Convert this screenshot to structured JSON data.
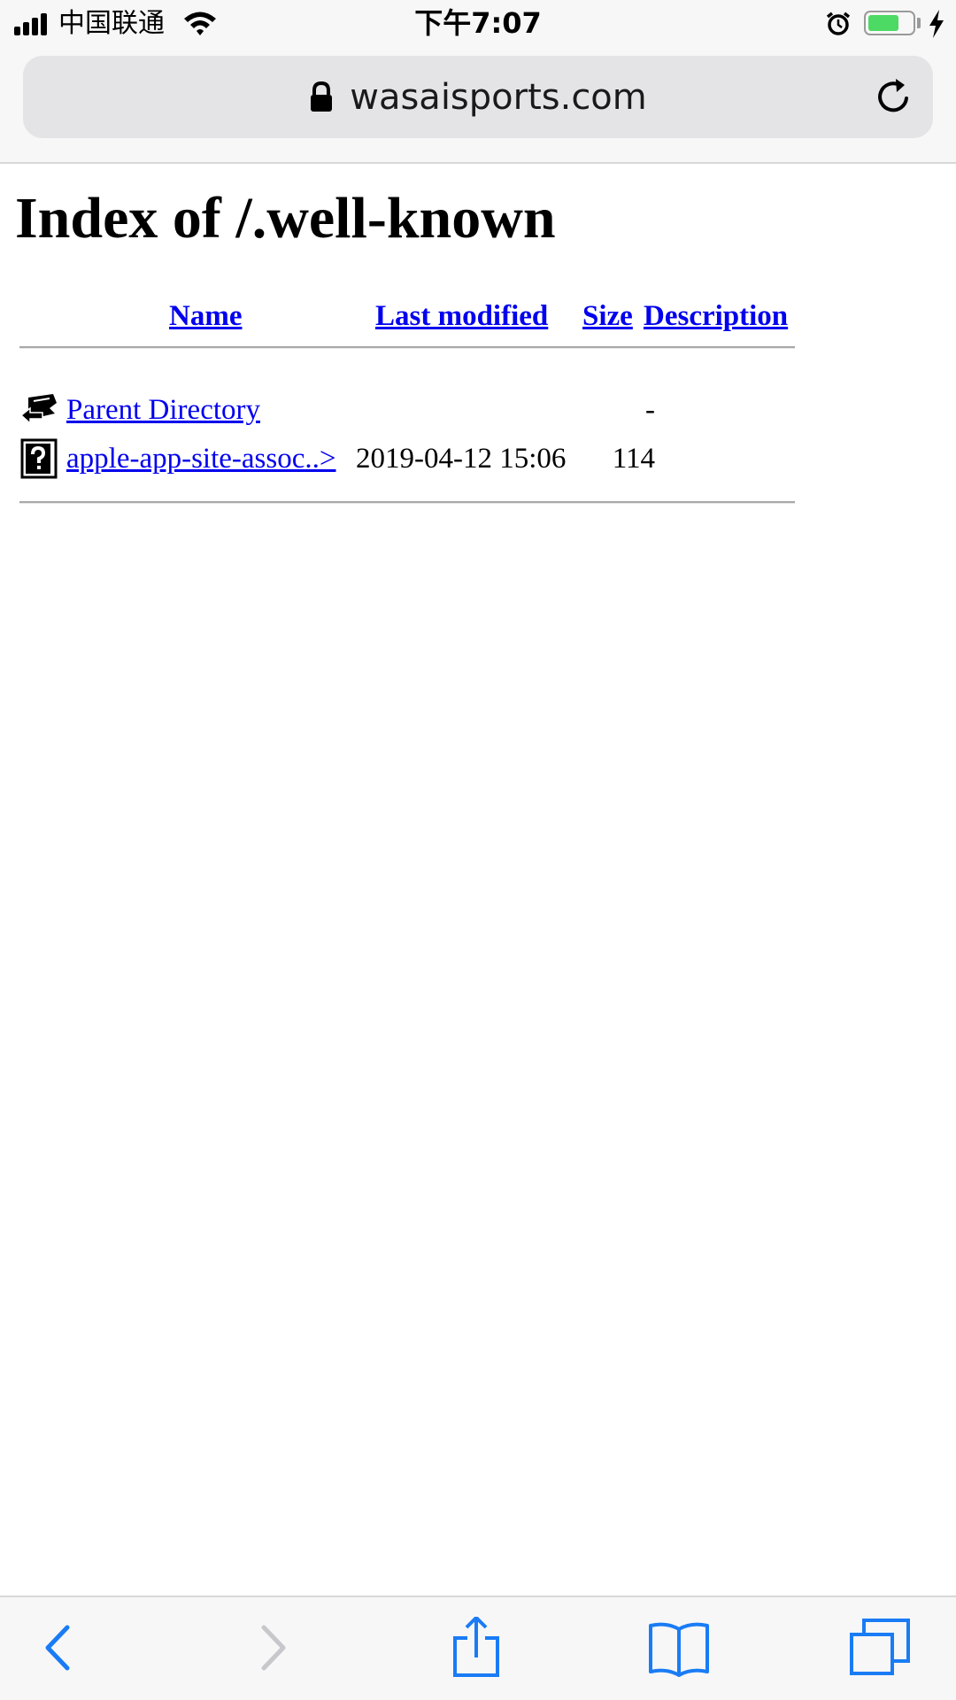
{
  "status_bar": {
    "carrier": "中国联通",
    "time": "下午7:07",
    "battery_level": 0.7,
    "battery_color": "#4cd964"
  },
  "browser": {
    "url": "wasaisports.com",
    "icons": {
      "lock": "lock-icon",
      "reload": "reload-icon"
    }
  },
  "page": {
    "title": "Index of /.well-known",
    "columns": {
      "name": "Name",
      "last_modified": "Last modified",
      "size": "Size",
      "description": "Description"
    },
    "rows": [
      {
        "icon": "back-folder-icon",
        "name": "Parent Directory",
        "last_modified": "",
        "size": "-",
        "description": ""
      },
      {
        "icon": "unknown-file-icon",
        "name": "apple-app-site-assoc..>",
        "last_modified": "2019-04-12 15:06",
        "size": "114",
        "description": ""
      }
    ],
    "link_color": "#0000ee"
  },
  "toolbar": {
    "buttons": [
      "back-icon",
      "forward-icon",
      "share-icon",
      "bookmarks-icon",
      "tabs-icon"
    ],
    "accent": "#1a7cf5",
    "disabled": "#c7c7cc"
  }
}
